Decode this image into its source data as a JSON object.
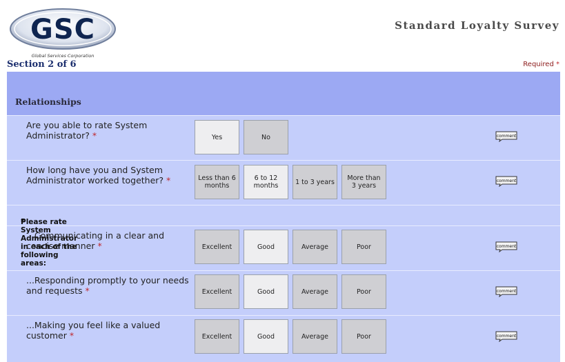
{
  "header": {
    "logo_text": "GSC",
    "logo_subtitle": "Global Services Corporation",
    "survey_title": "Standard Loyalty Survey",
    "section": "Section 2 of 6",
    "required_label": "Required",
    "required_marker": "*"
  },
  "panel": {
    "title": "Relationships",
    "areas_prompt": "Please rate System Administrator in each of the following areas:",
    "comment_label": "comment",
    "questions": [
      {
        "text": "Are you able to rate System Administrator?",
        "options": [
          "Yes",
          "No"
        ]
      },
      {
        "text": "How long have you and System Administrator worked together?",
        "options": [
          "Less than 6 months",
          "6 to 12 months",
          "1 to 3 years",
          "More than 3 years"
        ]
      },
      {
        "text": "...Communicating in a clear and concise manner",
        "options": [
          "Excellent",
          "Good",
          "Average",
          "Poor"
        ]
      },
      {
        "text": "...Responding promptly to your needs and requests",
        "options": [
          "Excellent",
          "Good",
          "Average",
          "Poor"
        ]
      },
      {
        "text": "...Making you feel like a valued customer",
        "options": [
          "Excellent",
          "Good",
          "Average",
          "Poor"
        ]
      }
    ]
  },
  "colors": {
    "panel_bg": "#c4cefb",
    "header_bg": "#9ca9f3",
    "required_star": "#c0282d",
    "section_text": "#1c2f6e"
  }
}
